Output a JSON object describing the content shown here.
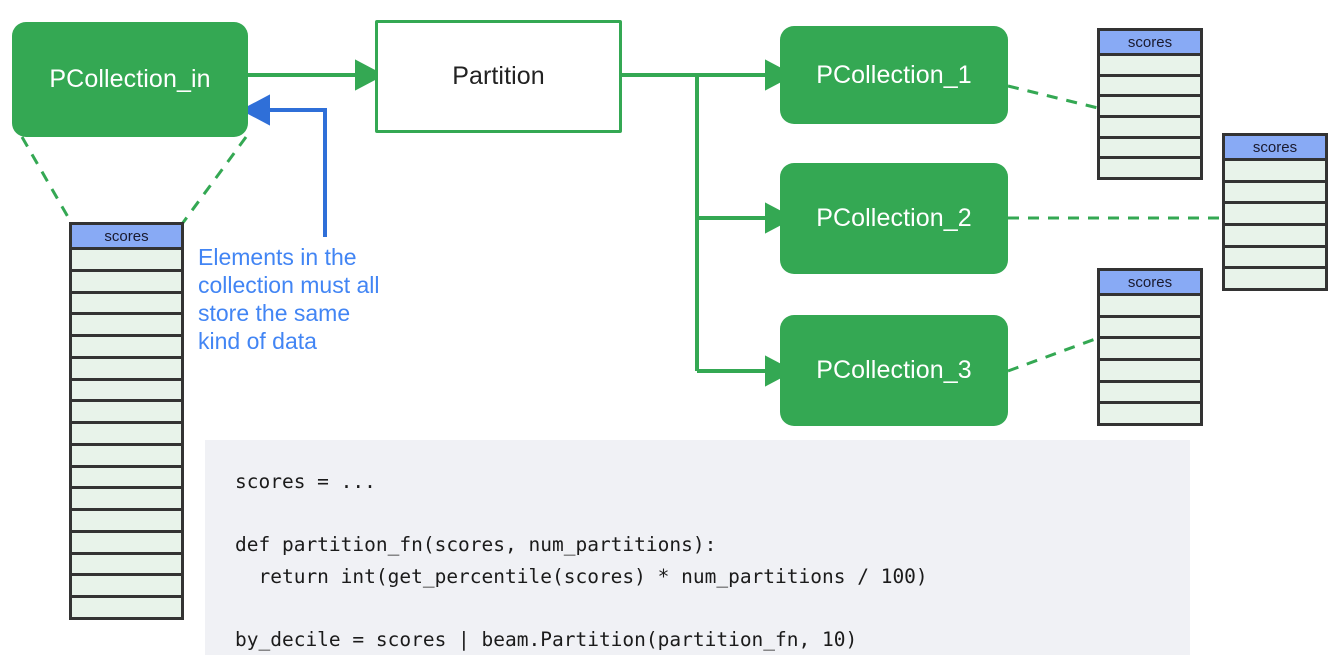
{
  "diagram": {
    "title": "Apache Beam Partition transform diagram",
    "colors": {
      "green_fill": "#34a853",
      "green_stroke": "#34a853",
      "blue_accent": "#4285f4",
      "table_header": "#88aaf5",
      "table_cell": "#e8f3ea",
      "table_border": "#333333",
      "code_background": "#f0f1f5"
    }
  },
  "nodes": {
    "input": {
      "label": "PCollection_in",
      "style": "filled"
    },
    "transform": {
      "label": "Partition",
      "style": "outline"
    },
    "outputs": [
      {
        "label": "PCollection_1",
        "style": "filled"
      },
      {
        "label": "PCollection_2",
        "style": "filled"
      },
      {
        "label": "PCollection_3",
        "style": "filled"
      }
    ]
  },
  "tables": {
    "input_table": {
      "header": "scores",
      "row_count": 17
    },
    "output_tables": [
      {
        "header": "scores",
        "row_count": 6
      },
      {
        "header": "scores",
        "row_count": 6
      },
      {
        "header": "scores",
        "row_count": 6
      }
    ]
  },
  "annotation": {
    "text": "Elements in the\ncollection must all\nstore the same\nkind of data"
  },
  "code": {
    "language": "python",
    "text": "scores = ...\n\ndef partition_fn(scores, num_partitions):\n  return int(get_percentile(scores) * num_partitions / 100)\n\nby_decile = scores | beam.Partition(partition_fn, 10)"
  }
}
